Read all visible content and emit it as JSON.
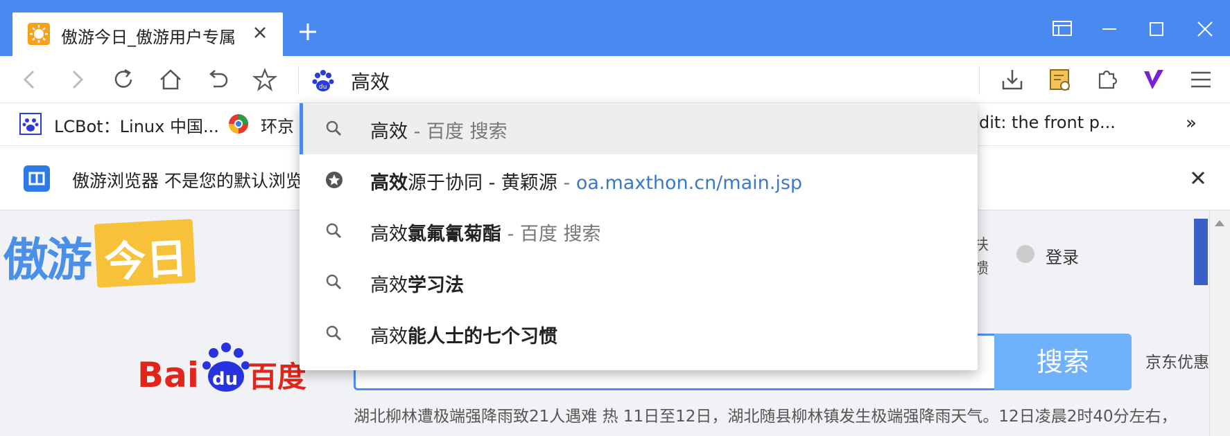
{
  "tab": {
    "title": "傲游今日_傲游用户专属"
  },
  "address": {
    "value": "高效"
  },
  "bookmarks": {
    "items": [
      {
        "label": "LCBot：Linux 中国..."
      },
      {
        "label": "环京"
      },
      {
        "label": "dit: the front p..."
      }
    ],
    "overflow": "»"
  },
  "infobar": {
    "message": "傲游浏览器 不是您的默认浏览"
  },
  "dropdown": {
    "items": [
      {
        "prefix": "高效",
        "bold": "",
        "suffix": " - 百度 搜索",
        "url": "",
        "icon": "search-icon"
      },
      {
        "prefix": "",
        "bold": "高效",
        "mid": "源于协同 - 黄颖源",
        "sep": " - ",
        "url": "oa.maxthon.cn/main.jsp",
        "icon": "bookmark-star-icon"
      },
      {
        "prefix": "高效",
        "bold": "氯氟氰菊酯",
        "suffix": " - 百度 搜索",
        "icon": "search-icon"
      },
      {
        "prefix": "高效",
        "bold": "学习法",
        "suffix": "",
        "icon": "search-icon"
      },
      {
        "prefix": "高效",
        "bold": "能人士的七个习惯",
        "suffix": "",
        "icon": "search-icon"
      }
    ]
  },
  "page": {
    "logo_left": "傲游",
    "logo_right": "今日",
    "side_a": "扶",
    "side_b": "馈",
    "login": "登录",
    "search_button": "搜索",
    "jd_text": "京东优惠",
    "news": "湖北柳林遭极端强降雨致21人遇难 热 11日至12日，湖北随县柳林镇发生极端强降雨天气。12日凌晨2时40分左右，"
  },
  "colors": {
    "titlebar": "#4a8af0",
    "accent": "#4a8af0",
    "search_button": "#6fb1fb"
  }
}
